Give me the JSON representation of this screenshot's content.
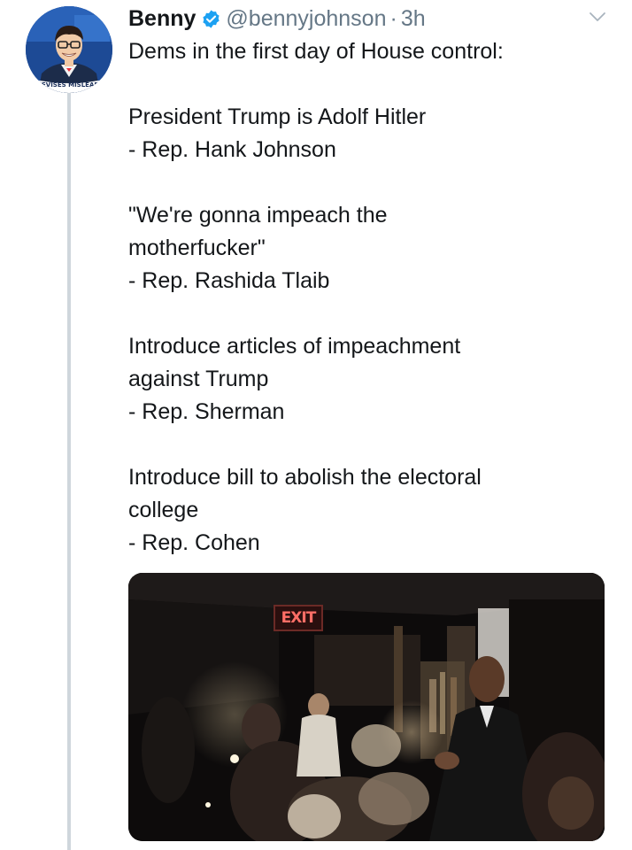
{
  "tweet": {
    "author_name": "Benny",
    "handle": "@bennyjohnson",
    "separator": "·",
    "time": "3h",
    "avatar_caption": "DEVISES MISLEADI",
    "lines": [
      [
        "Dems in the first day of House control:"
      ],
      [
        "President Trump is Adolf Hitler",
        "- Rep. Hank Johnson"
      ],
      [
        "\"We're gonna impeach the",
        "motherfucker\"",
        "- Rep. Rashida Tlaib"
      ],
      [
        "Introduce articles of impeachment",
        "against Trump",
        "- Rep. Sherman"
      ],
      [
        "Introduce bill to abolish the electoral",
        "college",
        "- Rep. Cohen"
      ]
    ],
    "media": {
      "sign_text": "EXIT"
    }
  },
  "icons": {
    "verified": "verified-badge-icon",
    "menu": "chevron-down-icon"
  },
  "colors": {
    "text": "#14171a",
    "secondary": "#657786",
    "verified": "#1da1f2",
    "thread_line": "#cfd6dc"
  }
}
